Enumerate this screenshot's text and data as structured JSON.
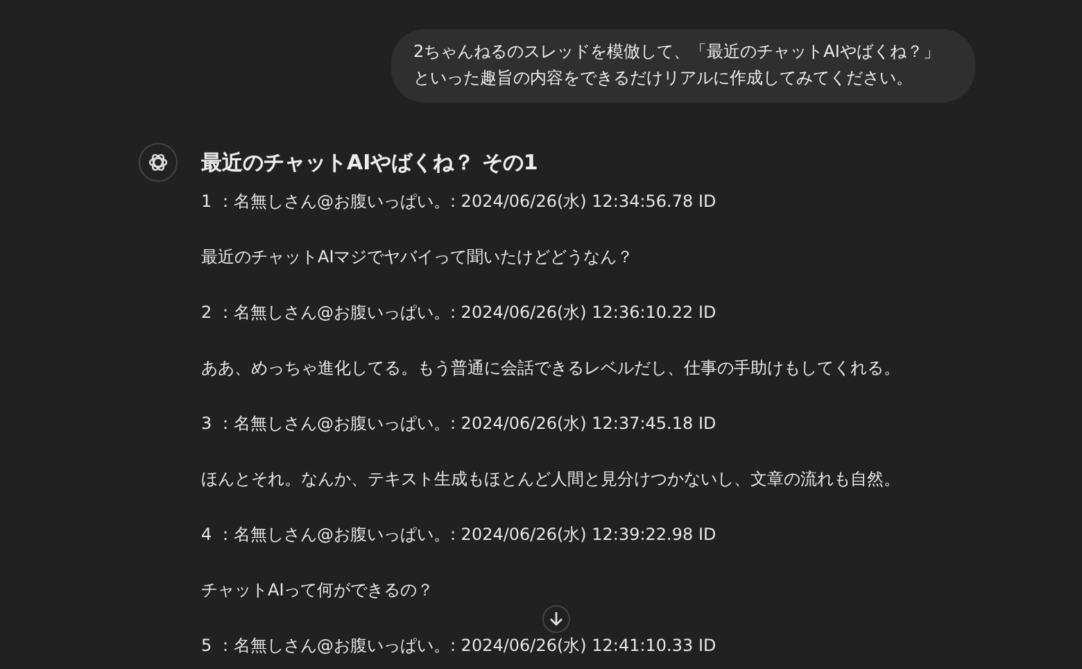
{
  "user_message": {
    "lines": [
      "2ちゃんねるのスレッドを模倣して、「最近のチャットAIやばくね？」",
      "といった趣旨の内容をできるだけリアルに作成してみてください。"
    ]
  },
  "response": {
    "title": "最近のチャットAIやばくね？ その1",
    "lines": [
      "1 ：名無しさん@お腹いっぱい。: 2024/06/26(水) 12:34:56.78 ID",
      "最近のチャットAIマジでヤバイって聞いたけどどうなん？",
      "2 ：名無しさん@お腹いっぱい。: 2024/06/26(水) 12:36:10.22 ID",
      "ああ、めっちゃ進化してる。もう普通に会話できるレベルだし、仕事の手助けもしてくれる。",
      "3 ：名無しさん@お腹いっぱい。: 2024/06/26(水) 12:37:45.18 ID",
      "ほんとそれ。なんか、テキスト生成もほとんど人間と見分けつかないし、文章の流れも自然。",
      "4 ：名無しさん@お腹いっぱい。: 2024/06/26(水) 12:39:22.98 ID",
      "チャットAIって何ができるの？",
      "5 ：名無しさん@お腹いっぱい。: 2024/06/26(水) 12:41:10.33 ID"
    ]
  }
}
